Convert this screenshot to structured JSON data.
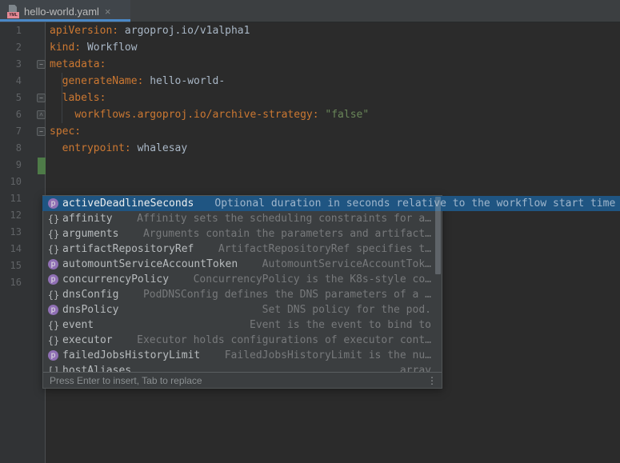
{
  "tab": {
    "title": "hello-world.yaml",
    "close_icon": "×",
    "file_icon_label": "YML"
  },
  "editor": {
    "lines": [
      {
        "num": 1,
        "tokens": [
          [
            "key",
            "apiVersion:"
          ],
          [
            "val",
            " argoproj.io/v1alpha1"
          ]
        ],
        "fold": ""
      },
      {
        "num": 2,
        "tokens": [
          [
            "key",
            "kind:"
          ],
          [
            "val",
            " Workflow"
          ]
        ],
        "fold": ""
      },
      {
        "num": 3,
        "tokens": [
          [
            "key",
            "metadata:"
          ]
        ],
        "fold": "minus"
      },
      {
        "num": 4,
        "tokens": [
          [
            "val",
            "  "
          ],
          [
            "key",
            "generateName:"
          ],
          [
            "val",
            " hello-world-"
          ]
        ],
        "fold": ""
      },
      {
        "num": 5,
        "tokens": [
          [
            "val",
            "  "
          ],
          [
            "key",
            "labels:"
          ]
        ],
        "fold": "minus"
      },
      {
        "num": 6,
        "tokens": [
          [
            "val",
            "    "
          ],
          [
            "key",
            "workflows.argoproj.io/archive-strategy:"
          ],
          [
            "str",
            " \"false\""
          ]
        ],
        "fold": "end"
      },
      {
        "num": 7,
        "tokens": [
          [
            "key",
            "spec:"
          ]
        ],
        "fold": "minus"
      },
      {
        "num": 8,
        "tokens": [
          [
            "val",
            "  "
          ],
          [
            "key",
            "entrypoint:"
          ],
          [
            "val",
            " whalesay"
          ]
        ],
        "fold": ""
      },
      {
        "num": 9,
        "tokens": [],
        "fold": "",
        "added_marker": true
      },
      {
        "num": 10,
        "tokens": [],
        "fold": ""
      },
      {
        "num": 11,
        "tokens": [],
        "fold": ""
      },
      {
        "num": 12,
        "tokens": [],
        "fold": ""
      },
      {
        "num": 13,
        "tokens": [],
        "fold": ""
      },
      {
        "num": 14,
        "tokens": [],
        "fold": ""
      },
      {
        "num": 15,
        "tokens": [],
        "fold": ""
      },
      {
        "num": 16,
        "tokens": [],
        "fold": ""
      }
    ],
    "fold_glyphs": {
      "minus": "−",
      "end": "˄"
    }
  },
  "popup": {
    "items": [
      {
        "icon": "p",
        "label": "activeDeadlineSeconds",
        "desc": "Optional duration in seconds relative to the workflow start time",
        "selected": true
      },
      {
        "icon": "{}",
        "label": "affinity",
        "desc": "Affinity sets the scheduling constraints for a…"
      },
      {
        "icon": "{}",
        "label": "arguments",
        "desc": "Arguments contain the parameters and artifact…"
      },
      {
        "icon": "{}",
        "label": "artifactRepositoryRef",
        "desc": "ArtifactRepositoryRef specifies t…"
      },
      {
        "icon": "p",
        "label": "automountServiceAccountToken",
        "desc": "AutomountServiceAccountTok…"
      },
      {
        "icon": "p",
        "label": "concurrencyPolicy",
        "desc": "ConcurrencyPolicy is the K8s-style co…"
      },
      {
        "icon": "{}",
        "label": "dnsConfig",
        "desc": "PodDNSConfig defines the DNS parameters of a …"
      },
      {
        "icon": "p",
        "label": "dnsPolicy",
        "desc": "Set DNS policy for the pod."
      },
      {
        "icon": "{}",
        "label": "event",
        "desc": "Event is the event to bind to"
      },
      {
        "icon": "{}",
        "label": "executor",
        "desc": "Executor holds configurations of executor cont…"
      },
      {
        "icon": "p",
        "label": "failedJobsHistoryLimit",
        "desc": "FailedJobsHistoryLimit is the nu…"
      },
      {
        "icon": "[]",
        "label": "hostAliases",
        "desc": "array"
      }
    ],
    "hint": "Press Enter to insert, Tab to replace",
    "more_icon": "⋮"
  },
  "colors": {
    "c-key": "#cc7832",
    "c-val": "#a9b7c6",
    "c-str": "#6a8759",
    "c-selection": "#1f5582",
    "c-tab-underline": "#4a88c7",
    "c-vcs-added": "#4e7b48",
    "c-prop-icon": "#8f6fb4",
    "c-yml-badge": "#e48995"
  }
}
